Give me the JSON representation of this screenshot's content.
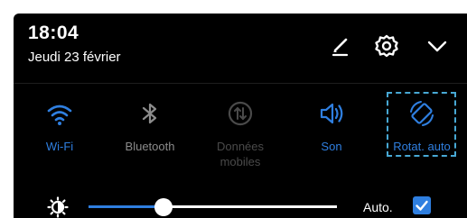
{
  "status": {
    "time": "18:04",
    "date": "Jeudi 23 février"
  },
  "header_icons": [
    {
      "icon": "pencil-edit-icon"
    },
    {
      "icon": "gear-icon"
    },
    {
      "icon": "chevron-down-icon"
    }
  ],
  "toggles": [
    {
      "icon": "wifi-icon",
      "label": "Wi-Fi",
      "state": "active"
    },
    {
      "icon": "bluetooth-icon",
      "label": "Bluetooth",
      "state": "inactive"
    },
    {
      "icon": "mobile-data-icon",
      "label": "Données\nmobiles",
      "state": "disabled"
    },
    {
      "icon": "volume-icon",
      "label": "Son",
      "state": "active"
    },
    {
      "icon": "auto-rotate-icon",
      "label": "Rotat. auto",
      "state": "active",
      "highlighted": true
    }
  ],
  "brightness": {
    "icon": "brightness-icon",
    "level_fraction": 0.3,
    "auto_label": "Auto.",
    "auto_checked": true
  },
  "colors": {
    "accent": "#2f7fe0",
    "background": "#000000",
    "highlight_border": "#47a8d4",
    "inactive": "#8c8c8c",
    "disabled": "#4a4a4a"
  }
}
